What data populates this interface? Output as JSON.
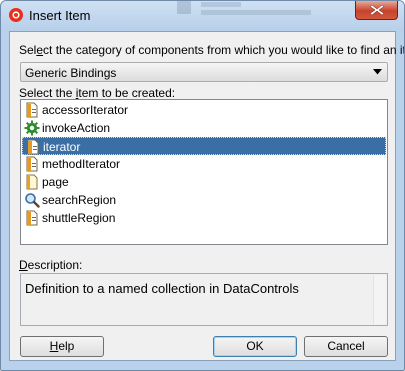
{
  "window": {
    "title": "Insert Item",
    "close_icon": "close-icon",
    "app_icon": "oracle-jdeveloper-icon"
  },
  "category": {
    "label_pre": "Sel",
    "label_key": "e",
    "label_post": "ct the category of components from which you would like to find an item:",
    "selected": "Generic Bindings",
    "dropdown_icon": "chevron-down-icon"
  },
  "items_section": {
    "label_pre": "Select the ",
    "label_key": "i",
    "label_post": "tem to be created:",
    "items": [
      {
        "label": "accessorIterator",
        "icon": "binding-page-icon",
        "selected": false
      },
      {
        "label": "invokeAction",
        "icon": "gear-icon",
        "selected": false
      },
      {
        "label": "iterator",
        "icon": "binding-page-icon",
        "selected": true
      },
      {
        "label": "methodIterator",
        "icon": "binding-page-icon",
        "selected": false
      },
      {
        "label": "page",
        "icon": "page-icon",
        "selected": false
      },
      {
        "label": "searchRegion",
        "icon": "magnifier-icon",
        "selected": false
      },
      {
        "label": "shuttleRegion",
        "icon": "binding-page-icon",
        "selected": false
      }
    ]
  },
  "description": {
    "label_pre": "",
    "label_key": "D",
    "label_post": "escription:",
    "text": "Definition to a named collection in DataControls"
  },
  "buttons": {
    "help_key": "H",
    "help_rest": "elp",
    "ok": "OK",
    "cancel": "Cancel"
  },
  "colors": {
    "selection": "#3a6ea5",
    "title_bar": "#b9d1ea",
    "close_button": "#c7432b"
  }
}
